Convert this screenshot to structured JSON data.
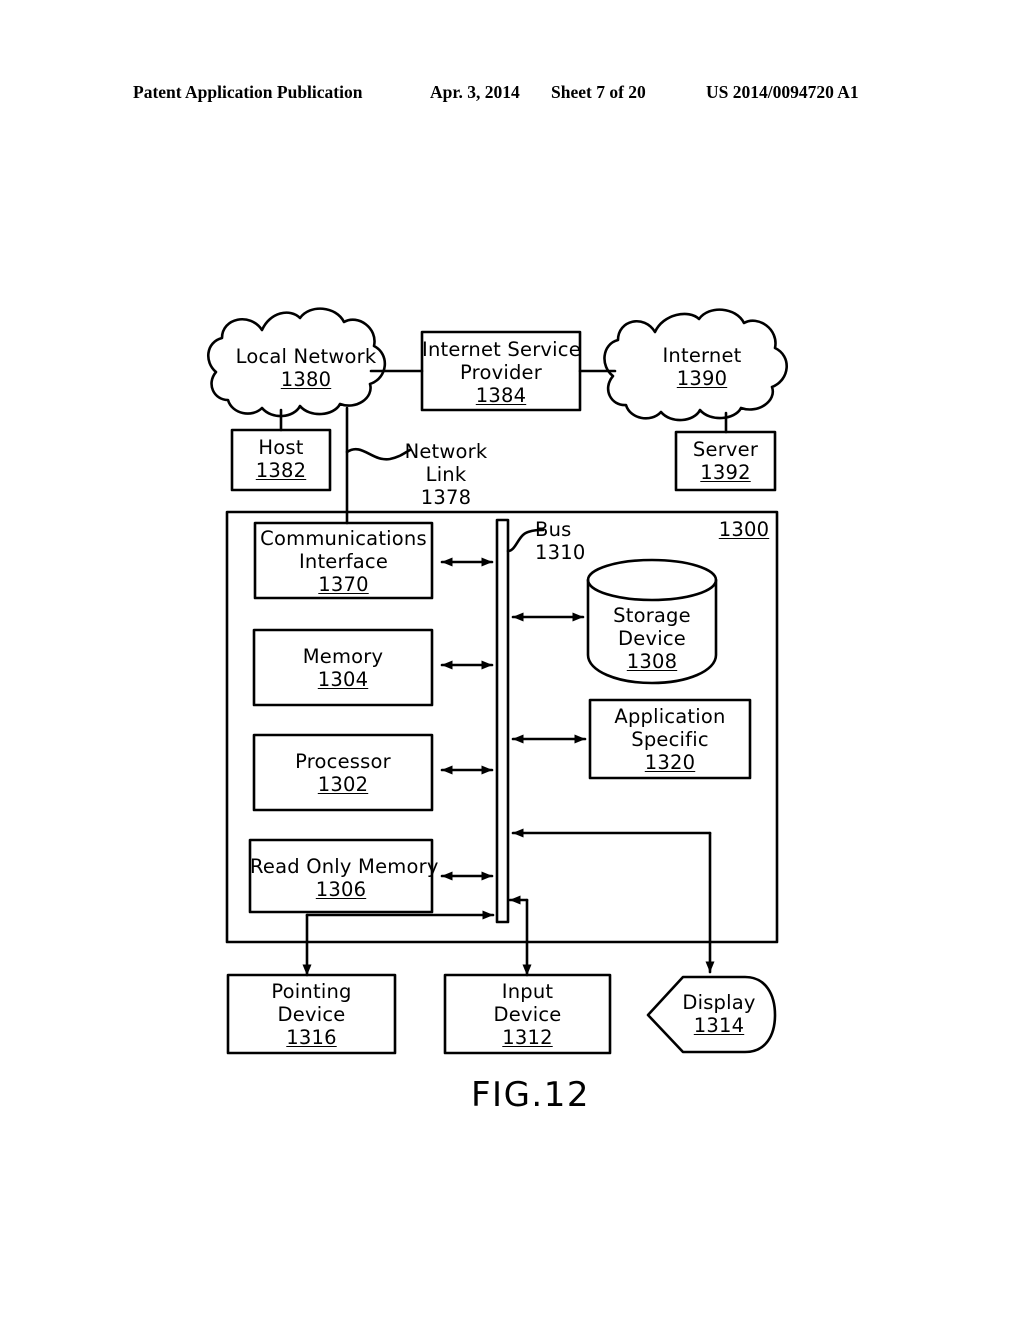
{
  "header": {
    "publication": "Patent Application Publication",
    "date": "Apr. 3, 2014",
    "sheet": "Sheet 7 of 20",
    "number": "US 2014/0094720 A1"
  },
  "figure": {
    "caption": "FIG.12",
    "system_ref": "1300",
    "bus": {
      "label": "Bus",
      "ref": "1310"
    },
    "network_link": {
      "line1": "Network",
      "line2": "Link",
      "ref": "1378"
    },
    "nodes": {
      "local_network": {
        "label": "Local  Network",
        "ref": "1380",
        "shape": "cloud"
      },
      "isp": {
        "line1": "Internet  Service",
        "line2": "Provider",
        "ref": "1384",
        "shape": "rect"
      },
      "internet": {
        "label": "Internet",
        "ref": "1390",
        "shape": "cloud"
      },
      "host": {
        "label": "Host",
        "ref": "1382",
        "shape": "rect"
      },
      "server": {
        "label": "Server",
        "ref": "1392",
        "shape": "rect"
      },
      "communications_interface": {
        "line1": "Communications",
        "line2": "Interface",
        "ref": "1370",
        "shape": "rect"
      },
      "memory": {
        "label": "Memory",
        "ref": "1304",
        "shape": "rect"
      },
      "processor": {
        "label": "Processor",
        "ref": "1302",
        "shape": "rect"
      },
      "read_only_memory": {
        "label": "Read  Only  Memory",
        "ref": "1306",
        "shape": "rect"
      },
      "storage_device": {
        "line1": "Storage",
        "line2": "Device",
        "ref": "1308",
        "shape": "cylinder"
      },
      "application_specific": {
        "line1": "Application",
        "line2": "Specific",
        "ref": "1320",
        "shape": "rect"
      },
      "pointing_device": {
        "line1": "Pointing",
        "line2": "Device",
        "ref": "1316",
        "shape": "rect"
      },
      "input_device": {
        "line1": "Input",
        "line2": "Device",
        "ref": "1312",
        "shape": "rect"
      },
      "display": {
        "label": "Display",
        "ref": "1314",
        "shape": "monitor"
      }
    }
  },
  "colors": {
    "ink": "#000000",
    "paper": "#ffffff"
  }
}
